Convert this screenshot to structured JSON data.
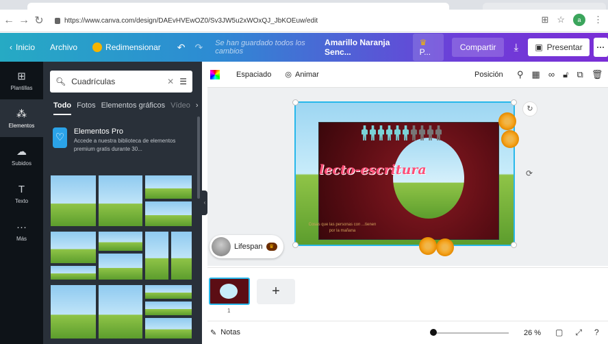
{
  "browser": {
    "url": "https://www.canva.com/design/DAEvHVEwOZ0/Sv3JW5u2xWOxQJ_JbKOEuw/edit",
    "profile_initial": "a"
  },
  "topbar": {
    "home": "Inicio",
    "file": "Archivo",
    "resize": "Redimensionar",
    "saved_status": "Se han guardado todos los cambios",
    "design_name": "Amarillo Naranja Senc...",
    "pro_label": "P...",
    "share": "Compartir",
    "present": "Presentar"
  },
  "rail": {
    "items": [
      {
        "label": "Plantillas",
        "icon": "layout-icon"
      },
      {
        "label": "Elementos",
        "icon": "shapes-icon"
      },
      {
        "label": "Subidos",
        "icon": "upload-icon"
      },
      {
        "label": "Texto",
        "icon": "text-icon"
      },
      {
        "label": "Más",
        "icon": "more-icon"
      }
    ]
  },
  "panel": {
    "search_value": "Cuadrículas",
    "tabs": [
      "Todo",
      "Fotos",
      "Elementos gráficos",
      "Vídeo"
    ],
    "pro_title": "Elementos Pro",
    "pro_desc": "Accede a nuestra biblioteca de elementos premium gratis durante 30..."
  },
  "toolbar": {
    "spacing": "Espaciado",
    "animate": "Animar",
    "position": "Posición"
  },
  "slide": {
    "title": "lecto-escritura",
    "subtitle": "Cosas que las personas con ...tienen por la mañana"
  },
  "element_tag": {
    "label": "Lifespan"
  },
  "pages": {
    "page_number": "1"
  },
  "bottom": {
    "notes": "Notas",
    "zoom": "26 %"
  }
}
